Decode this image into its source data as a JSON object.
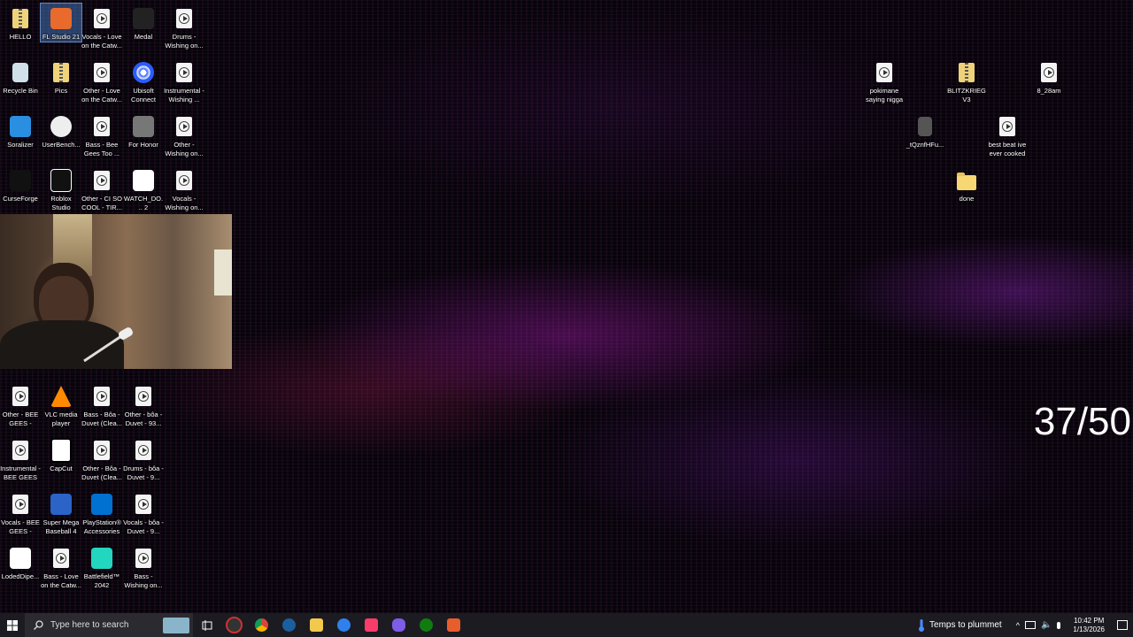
{
  "desktop": {
    "icons_left": [
      {
        "label": "HELLO",
        "type": "zip"
      },
      {
        "label": "FL Studio 21",
        "type": "app-fl",
        "selected": true
      },
      {
        "label": "Vocals - Love on the Catw...",
        "type": "media"
      },
      {
        "label": "Medal",
        "type": "app-medal"
      },
      {
        "label": "Drums - Wishing on...",
        "type": "media"
      },
      {
        "label": "Recycle Bin",
        "type": "recycle"
      },
      {
        "label": "Pics",
        "type": "zip"
      },
      {
        "label": "Other - Love on the Catw...",
        "type": "media"
      },
      {
        "label": "Ubisoft Connect",
        "type": "app-ubisoft"
      },
      {
        "label": "Instrumental - Wishing ...",
        "type": "media"
      },
      {
        "label": "Soralizer",
        "type": "app-soralizer"
      },
      {
        "label": "UserBench...",
        "type": "app-userbench"
      },
      {
        "label": "Bass - Bee Gees Too ...",
        "type": "media"
      },
      {
        "label": "For Honor",
        "type": "app-forhonor"
      },
      {
        "label": "Other - Wishing on...",
        "type": "media"
      },
      {
        "label": "CurseForge",
        "type": "app-curseforge"
      },
      {
        "label": "Roblox Studio",
        "type": "app-roblox"
      },
      {
        "label": "Other - CI SO COOL - TIR...",
        "type": "media"
      },
      {
        "label": "WATCH_DO... 2",
        "type": "app-watchdogs"
      },
      {
        "label": "Vocals - Wishing on...",
        "type": "media"
      },
      {
        "label": "Other - BEE GEES - TOO...",
        "type": "media"
      },
      {
        "label": "VLC media player",
        "type": "app-vlc"
      },
      {
        "label": "Bass - Bôa - Duvet (Clea...",
        "type": "media"
      },
      {
        "label": "Other - bôa - Duvet - 93...",
        "type": "media"
      },
      {
        "label": "Instrumental - BEE GEES ...",
        "type": "media"
      },
      {
        "label": "CapCut",
        "type": "app-capcut"
      },
      {
        "label": "Other - Bôa - Duvet (Clea...",
        "type": "media"
      },
      {
        "label": "Drums - bôa - Duvet - 9...",
        "type": "media"
      },
      {
        "label": "Vocals - BEE GEES - TOO...",
        "type": "media"
      },
      {
        "label": "Super Mega Baseball 4",
        "type": "app-smb"
      },
      {
        "label": "PlayStation® Accessories",
        "type": "app-ps"
      },
      {
        "label": "Vocals - bôa - Duvet - 9...",
        "type": "media"
      },
      {
        "label": "LodedDipe...",
        "type": "app-ab3"
      },
      {
        "label": "Bass - Love on the Catw...",
        "type": "media"
      },
      {
        "label": "Battlefield™ 2042",
        "type": "app-bf"
      },
      {
        "label": "Bass - Wishing on...",
        "type": "media"
      }
    ],
    "icons_right": [
      {
        "label": "pokimane saying nigga",
        "type": "media"
      },
      {
        "label": "BLITZKRIEG V3",
        "type": "zip"
      },
      {
        "label": "8_28am",
        "type": "media"
      },
      {
        "label": "_tQznfHFu...",
        "type": "image"
      },
      {
        "label": "best beat ive ever cooked",
        "type": "media"
      },
      {
        "label": "done",
        "type": "folder"
      }
    ],
    "overlay_counter": "37/50"
  },
  "taskbar": {
    "search_placeholder": "Type here to search",
    "apps": [
      "file-explorer-thumb",
      "task-view-icon",
      "obs-icon",
      "chrome-icon",
      "steam-icon",
      "files-icon",
      "edge-icon",
      "itunes-icon",
      "discord-icon",
      "xbox-icon",
      "fl-icon"
    ],
    "weather_text": "Temps to plummet",
    "time": "10:42 PM",
    "date": "1/13/2026"
  },
  "colors": {
    "taskbar": "#1c1b22",
    "accent_purple": "#b91fd0",
    "accent_pink": "#e0286e"
  }
}
